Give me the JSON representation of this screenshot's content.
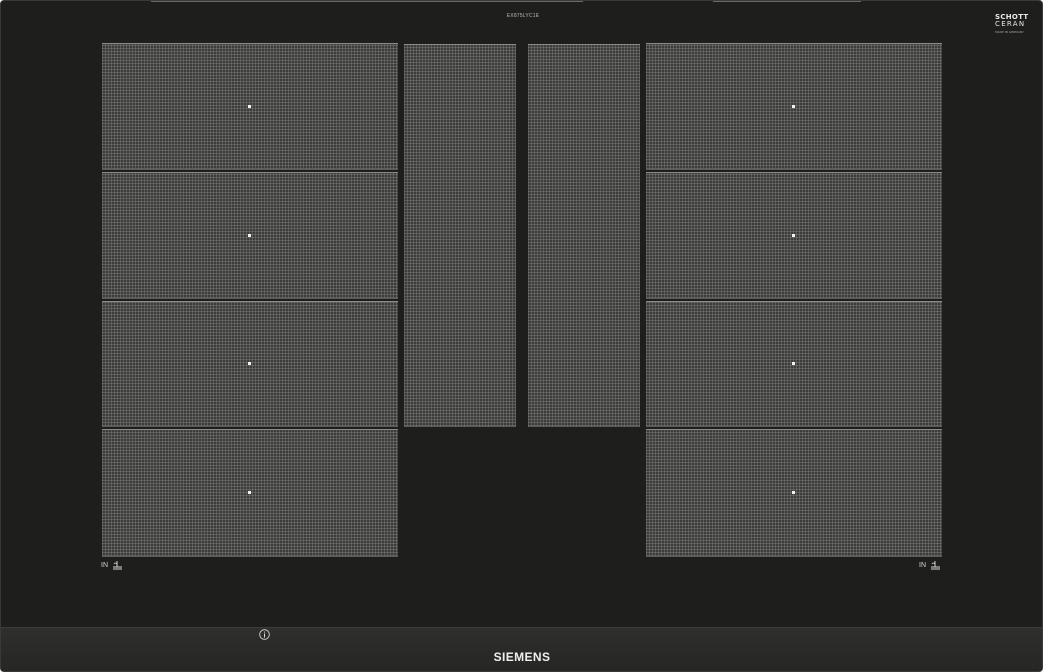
{
  "model_number": "EX875LYC1E",
  "glass_brand": {
    "line1": "SCHOTT",
    "line2": "CERAN",
    "line3": "MADE IN GERMANY"
  },
  "cooking_zones": {
    "left_column": [
      "zone",
      "zone",
      "zone",
      "zone"
    ],
    "center_column": [
      "zone",
      "zone"
    ],
    "right_column": [
      "zone",
      "zone",
      "zone",
      "zone"
    ]
  },
  "flex_labels": {
    "left": "IN",
    "right": "IN"
  },
  "icons": {
    "flex_icon": "flex-induction-icon",
    "info_icon": "info-icon"
  },
  "brand": "SIEMENS",
  "colors": {
    "glass": "#1e1e1d",
    "zone": "#3b3b3a",
    "zone_marker": "#f4f4f0",
    "control_bar": "#2a2a29",
    "text": "#f0f0ec"
  }
}
